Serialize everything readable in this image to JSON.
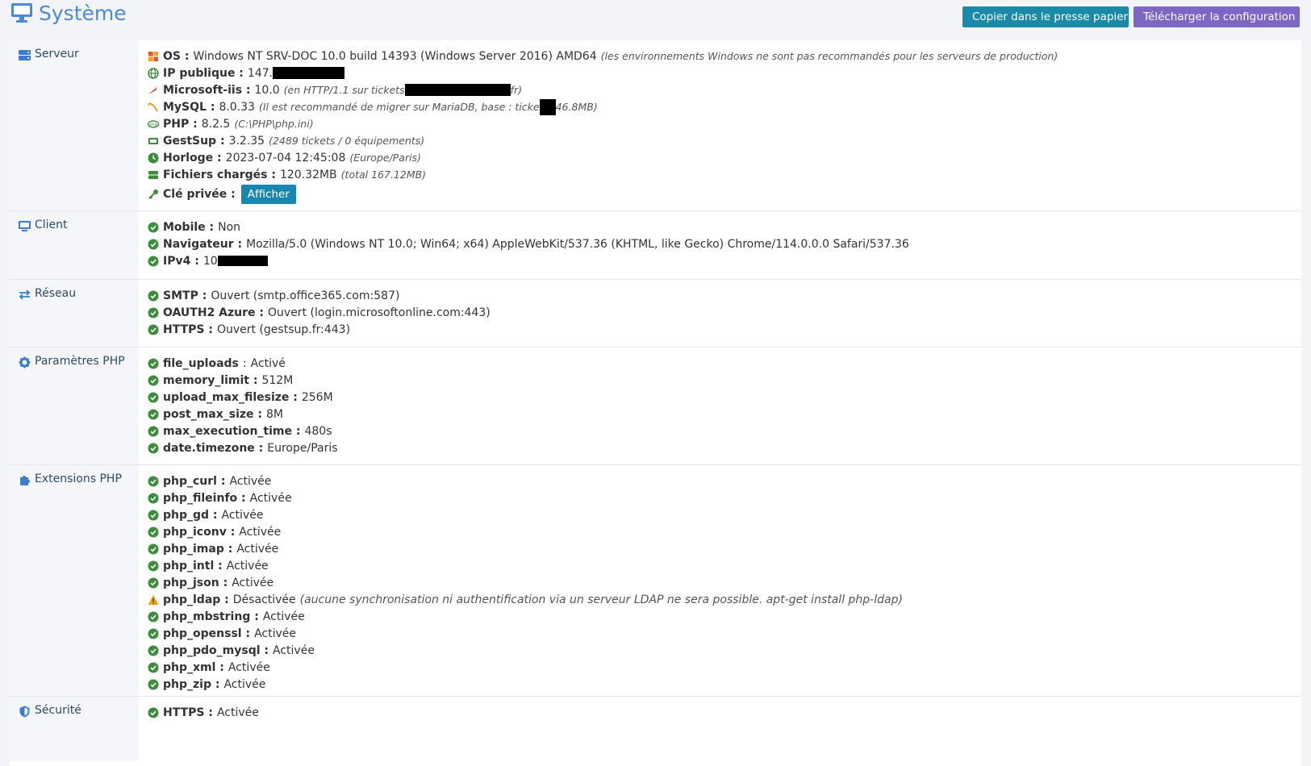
{
  "header": {
    "title": "Système",
    "copy_button": "Copier dans le presse papier",
    "download_button": "Télécharger la configuration"
  },
  "colors": {
    "title": "#4a8ad6",
    "copy_button_bg": "#1a8aa8",
    "download_button_bg": "#7c67c5",
    "ok": "#3c8d3c",
    "warning": "#f0a30a"
  },
  "serveur": {
    "label": "Serveur",
    "os_key": "OS :",
    "os_value": "Windows NT SRV-DOC 10.0 build 14393 (Windows Server 2016) AMD64",
    "os_note": "(les environnements Windows ne sont pas recommandés pour les serveurs de production)",
    "ip_key": "IP publique :",
    "ip_value": "147.",
    "iis_key": "Microsoft-iis :",
    "iis_value": "10.0",
    "iis_note_a": "(en HTTP/1.1 sur tickets",
    "iis_note_b": "fr)",
    "mysql_key": "MySQL :",
    "mysql_value": "8.0.33",
    "mysql_note_a": "(Il est recommandé de migrer sur MariaDB, base : ticke",
    "mysql_note_b": "46.8MB)",
    "php_key": "PHP :",
    "php_value": "8.2.5",
    "php_note": "(C:\\PHP\\php.ini)",
    "gestsup_key": "GestSup :",
    "gestsup_value": "3.2.35",
    "gestsup_note": "(2489 tickets / 0 équipements)",
    "horloge_key": "Horloge :",
    "horloge_value": "2023-07-04 12:45:08",
    "horloge_note": "(Europe/Paris)",
    "fichiers_key": "Fichiers chargés :",
    "fichiers_value": "120.32MB",
    "fichiers_note": "(total 167.12MB)",
    "cle_key": "Clé privée :",
    "cle_button": "Afficher"
  },
  "client": {
    "label": "Client",
    "rows": [
      {
        "key": "Mobile :",
        "value": "Non"
      },
      {
        "key": "Navigateur :",
        "value": "Mozilla/5.0 (Windows NT 10.0; Win64; x64) AppleWebKit/537.36 (KHTML, like Gecko) Chrome/114.0.0.0 Safari/537.36"
      },
      {
        "key": "IPv4 :",
        "value": "10"
      }
    ]
  },
  "reseau": {
    "label": "Réseau",
    "rows": [
      {
        "key": "SMTP :",
        "value": "Ouvert (smtp.office365.com:587)"
      },
      {
        "key": "OAUTH2 Azure :",
        "value": "Ouvert (login.microsoftonline.com:443)"
      },
      {
        "key": "HTTPS :",
        "value": "Ouvert (gestsup.fr:443)"
      }
    ]
  },
  "params": {
    "label": "Paramètres PHP",
    "rows": [
      {
        "key": "file_uploads",
        "value": "Activé"
      },
      {
        "key": "memory_limit :",
        "value": "512M"
      },
      {
        "key": "upload_max_filesize :",
        "value": "256M"
      },
      {
        "key": "post_max_size :",
        "value": "8M"
      },
      {
        "key": "max_execution_time :",
        "value": "480s"
      },
      {
        "key": "date.timezone :",
        "value": "Europe/Paris"
      }
    ]
  },
  "extensions": {
    "label": "Extensions PHP",
    "rows": [
      {
        "key": "php_curl :",
        "value": "Activée"
      },
      {
        "key": "php_fileinfo :",
        "value": "Activée"
      },
      {
        "key": "php_gd :",
        "value": "Activée"
      },
      {
        "key": "php_iconv :",
        "value": "Activée"
      },
      {
        "key": "php_imap :",
        "value": "Activée"
      },
      {
        "key": "php_intl :",
        "value": "Activée"
      },
      {
        "key": "php_json :",
        "value": "Activée"
      },
      {
        "key": "php_ldap :",
        "value": "Désactivée",
        "note": "(aucune synchronisation ni authentification via un serveur LDAP ne sera possible. apt-get install php-ldap)"
      },
      {
        "key": "php_mbstring :",
        "value": "Activée"
      },
      {
        "key": "php_openssl :",
        "value": "Activée"
      },
      {
        "key": "php_pdo_mysql :",
        "value": "Activée"
      },
      {
        "key": "php_xml :",
        "value": "Activée"
      },
      {
        "key": "php_zip :",
        "value": "Activée"
      }
    ]
  },
  "securite": {
    "label": "Sécurité",
    "rows": [
      {
        "key": "HTTPS :",
        "value": "Activée"
      }
    ]
  }
}
